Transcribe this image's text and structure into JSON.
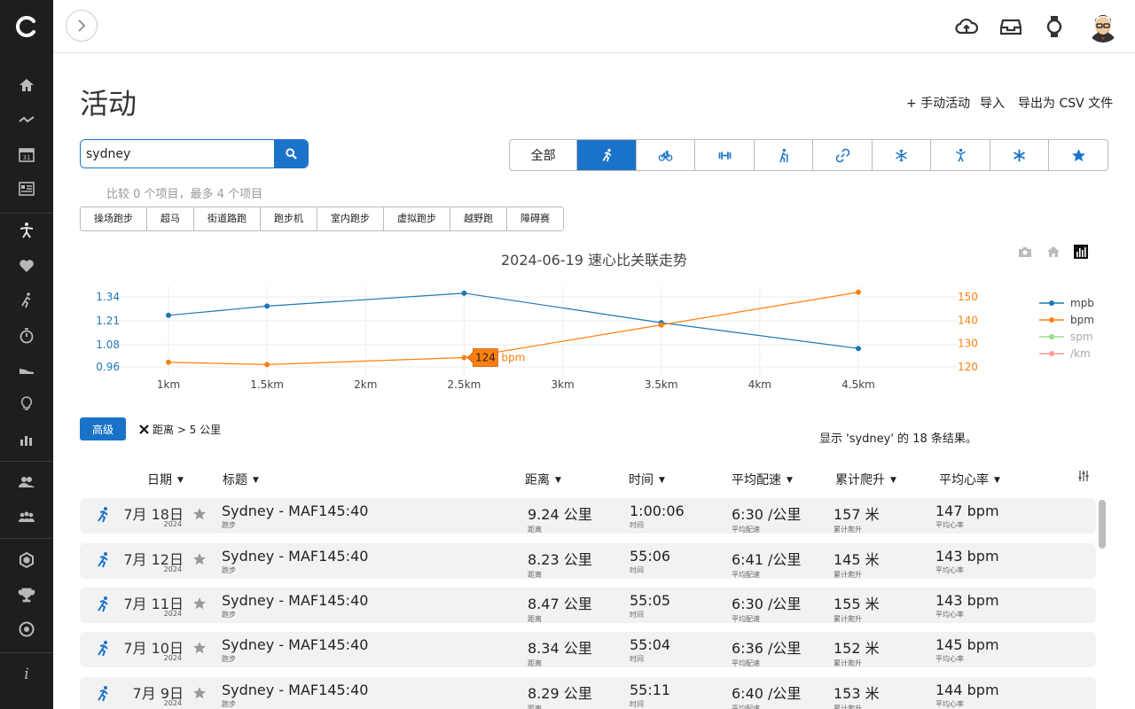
{
  "sidebar": {
    "items": [
      "home",
      "trend",
      "calendar",
      "report",
      "activities",
      "health",
      "training",
      "timer",
      "gear",
      "insights",
      "stats",
      "friends",
      "groups",
      "segments",
      "trophy",
      "goals",
      "info"
    ]
  },
  "page": {
    "title": "活动",
    "actions": [
      "+ 手动活动",
      "导入",
      "导出为 CSV 文件"
    ]
  },
  "search": {
    "value": "sydney"
  },
  "type_filter": {
    "all_label": "全部",
    "types": [
      "running",
      "cycling",
      "strength",
      "hiking",
      "multisport",
      "winter",
      "other",
      "misc",
      "favorites"
    ],
    "active": "running"
  },
  "compare_note": "比较 0 个项目，最多 4 个项目",
  "subtypes": [
    "操场跑步",
    "超马",
    "街道路跑",
    "跑步机",
    "室内跑步",
    "虚拟跑步",
    "越野跑",
    "障碍赛"
  ],
  "chart_data": {
    "type": "line",
    "title": "2024-06-19 速心比关联走势",
    "x": [
      1,
      2,
      3,
      4,
      5
    ],
    "x_ticks": [
      "1km",
      "1.5km",
      "2km",
      "2.5km",
      "3km",
      "3.5km",
      "4km",
      "4.5km"
    ],
    "x_tick_values": [
      1,
      1.5,
      2,
      2.5,
      3,
      3.5,
      4,
      4.5
    ],
    "y_left_ticks": [
      "0.96",
      "1.08",
      "1.21",
      "1.34"
    ],
    "y_left_tick_values": [
      0.96,
      1.08,
      1.21,
      1.34
    ],
    "y_right_ticks": [
      "120",
      "130",
      "140",
      "150"
    ],
    "y_right_tick_values": [
      120,
      130,
      140,
      150
    ],
    "series": [
      {
        "name": "mpb",
        "axis": "left",
        "color": "#1f77b4",
        "x": [
          1,
          1.5,
          2.5,
          3.5,
          4.5
        ],
        "values": [
          1.24,
          1.29,
          1.36,
          1.2,
          1.06
        ]
      },
      {
        "name": "bpm",
        "axis": "right",
        "color": "#ff7f0e",
        "x": [
          1,
          1.5,
          2.5,
          3.5,
          4.5
        ],
        "values": [
          122,
          121,
          124,
          138,
          152
        ]
      },
      {
        "name": "spm",
        "axis": "right",
        "color": "#98df8a",
        "values": []
      },
      {
        "name": "/km",
        "axis": "right",
        "color": "#ff9896",
        "values": []
      }
    ],
    "tooltip": {
      "value": "124",
      "unit": "bpm"
    },
    "legend": "right"
  },
  "advanced_label": "高级",
  "active_filter": "距离 > 5 公里",
  "result_text": "显示 'sydney' 的 18 条结果。",
  "columns": [
    "日期",
    "标题",
    "距离",
    "时间",
    "平均配速",
    "累计爬升",
    "平均心率"
  ],
  "sub_labels": {
    "type": "跑步",
    "distance": "距离",
    "time": "时间",
    "pace": "平均配速",
    "elev": "累计爬升",
    "hr": "平均心率"
  },
  "rows": [
    {
      "date": "7月 18日",
      "year": "2024",
      "title": "Sydney - MAF145:40",
      "distance": "9.24 公里",
      "time": "1:00:06",
      "pace": "6:30 /公里",
      "elev": "157 米",
      "hr": "147 bpm"
    },
    {
      "date": "7月 12日",
      "year": "2024",
      "title": "Sydney - MAF145:40",
      "distance": "8.23 公里",
      "time": "55:06",
      "pace": "6:41 /公里",
      "elev": "145 米",
      "hr": "143 bpm"
    },
    {
      "date": "7月 11日",
      "year": "2024",
      "title": "Sydney - MAF145:40",
      "distance": "8.47 公里",
      "time": "55:05",
      "pace": "6:30 /公里",
      "elev": "155 米",
      "hr": "143 bpm"
    },
    {
      "date": "7月 10日",
      "year": "2024",
      "title": "Sydney - MAF145:40",
      "distance": "8.34 公里",
      "time": "55:04",
      "pace": "6:36 /公里",
      "elev": "152 米",
      "hr": "145 bpm"
    },
    {
      "date": "7月 9日",
      "year": "2024",
      "title": "Sydney - MAF145:40",
      "distance": "8.29 公里",
      "time": "55:11",
      "pace": "6:40 /公里",
      "elev": "153 米",
      "hr": "144 bpm"
    }
  ]
}
